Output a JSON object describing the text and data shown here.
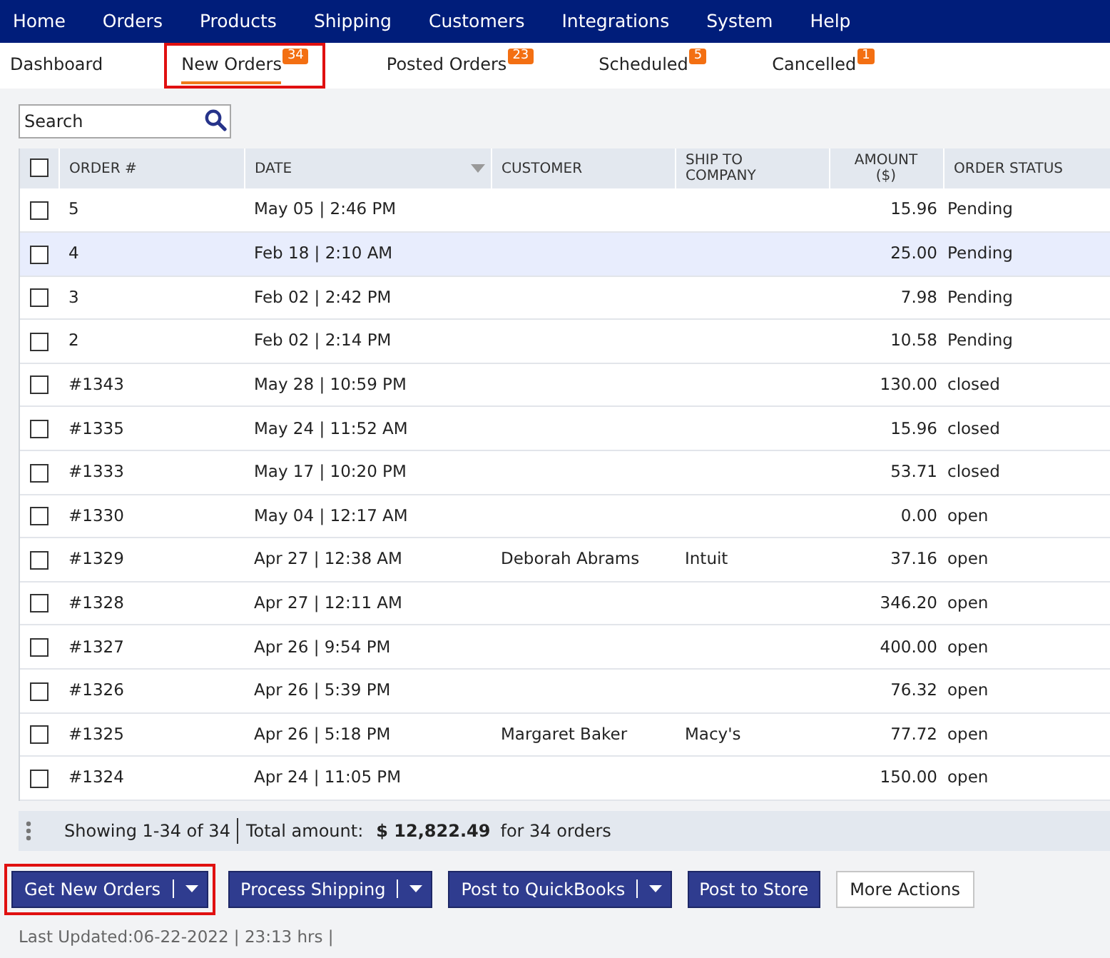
{
  "menu": [
    "Home",
    "Orders",
    "Products",
    "Shipping",
    "Customers",
    "Integrations",
    "System",
    "Help"
  ],
  "tabs": [
    {
      "label": "Dashboard",
      "selected": false,
      "highlighted": false
    },
    {
      "label": "New Orders",
      "count": "34",
      "selected": true,
      "highlighted": true
    },
    {
      "label": "Posted Orders",
      "count": "23",
      "selected": false,
      "highlighted": false
    },
    {
      "label": "Scheduled",
      "count": "5",
      "selected": false,
      "highlighted": false
    },
    {
      "label": "Cancelled",
      "count": "1",
      "selected": false,
      "highlighted": false
    }
  ],
  "search": {
    "placeholder": "Search"
  },
  "table": {
    "columns": [
      "ORDER #",
      "DATE",
      "CUSTOMER",
      "SHIP TO COMPANY",
      "AMOUNT ($)",
      "ORDER STATUS"
    ],
    "header_checked": false,
    "rows": [
      {
        "order": "5",
        "date": "May 05 | 2:46 PM",
        "customer": "",
        "ship_to": "",
        "amount": "15.96",
        "status": "Pending",
        "checked": false,
        "selected": false
      },
      {
        "order": "4",
        "date": "Feb 18 | 2:10 AM",
        "customer": "",
        "ship_to": "",
        "amount": "25.00",
        "status": "Pending",
        "checked": false,
        "selected": true
      },
      {
        "order": "3",
        "date": "Feb 02 | 2:42 PM",
        "customer": "",
        "ship_to": "",
        "amount": "7.98",
        "status": "Pending",
        "checked": false,
        "selected": false
      },
      {
        "order": "2",
        "date": "Feb 02 | 2:14 PM",
        "customer": "",
        "ship_to": "",
        "amount": "10.58",
        "status": "Pending",
        "checked": false,
        "selected": false
      },
      {
        "order": "#1343",
        "date": "May 28 | 10:59 PM",
        "customer": "",
        "ship_to": "",
        "amount": "130.00",
        "status": "closed",
        "checked": false,
        "selected": false
      },
      {
        "order": "#1335",
        "date": "May 24 | 11:52 AM",
        "customer": "",
        "ship_to": "",
        "amount": "15.96",
        "status": "closed",
        "checked": false,
        "selected": false
      },
      {
        "order": "#1333",
        "date": "May 17 | 10:20 PM",
        "customer": "",
        "ship_to": "",
        "amount": "53.71",
        "status": "closed",
        "checked": false,
        "selected": false
      },
      {
        "order": "#1330",
        "date": "May 04 | 12:17 AM",
        "customer": "",
        "ship_to": "",
        "amount": "0.00",
        "status": "open",
        "checked": false,
        "selected": false
      },
      {
        "order": "#1329",
        "date": "Apr 27 | 12:38 AM",
        "customer": "Deborah Abrams",
        "ship_to": "Intuit",
        "amount": "37.16",
        "status": "open",
        "checked": false,
        "selected": false
      },
      {
        "order": "#1328",
        "date": "Apr 27 | 12:11 AM",
        "customer": "",
        "ship_to": "",
        "amount": "346.20",
        "status": "open",
        "checked": false,
        "selected": false
      },
      {
        "order": "#1327",
        "date": "Apr 26 | 9:54 PM",
        "customer": "",
        "ship_to": "",
        "amount": "400.00",
        "status": "open",
        "checked": false,
        "selected": false
      },
      {
        "order": "#1326",
        "date": "Apr 26 | 5:39 PM",
        "customer": "",
        "ship_to": "",
        "amount": "76.32",
        "status": "open",
        "checked": false,
        "selected": false
      },
      {
        "order": "#1325",
        "date": "Apr 26 | 5:18 PM",
        "customer": "Margaret Baker",
        "ship_to": "Macy's",
        "amount": "77.72",
        "status": "open",
        "checked": false,
        "selected": false
      },
      {
        "order": "#1324",
        "date": "Apr 24 | 11:05 PM",
        "customer": "",
        "ship_to": "",
        "amount": "150.00",
        "status": "open",
        "checked": false,
        "selected": false
      }
    ]
  },
  "summary": {
    "showing": "Showing 1-34 of 34",
    "total_label": "Total amount:",
    "total": "$ 12,822.49",
    "suffix": "for 34 orders"
  },
  "actions": [
    {
      "label": "Get New Orders",
      "kind": "split",
      "highlighted": true
    },
    {
      "label": "Process Shipping",
      "kind": "split",
      "highlighted": false
    },
    {
      "label": "Post to QuickBooks",
      "kind": "split",
      "highlighted": false
    },
    {
      "label": "Post to Store",
      "kind": "primary",
      "highlighted": false
    },
    {
      "label": "More Actions",
      "kind": "secondary",
      "highlighted": false
    }
  ],
  "status_bar": "Last Updated:06-22-2022 | 23:13 hrs |"
}
